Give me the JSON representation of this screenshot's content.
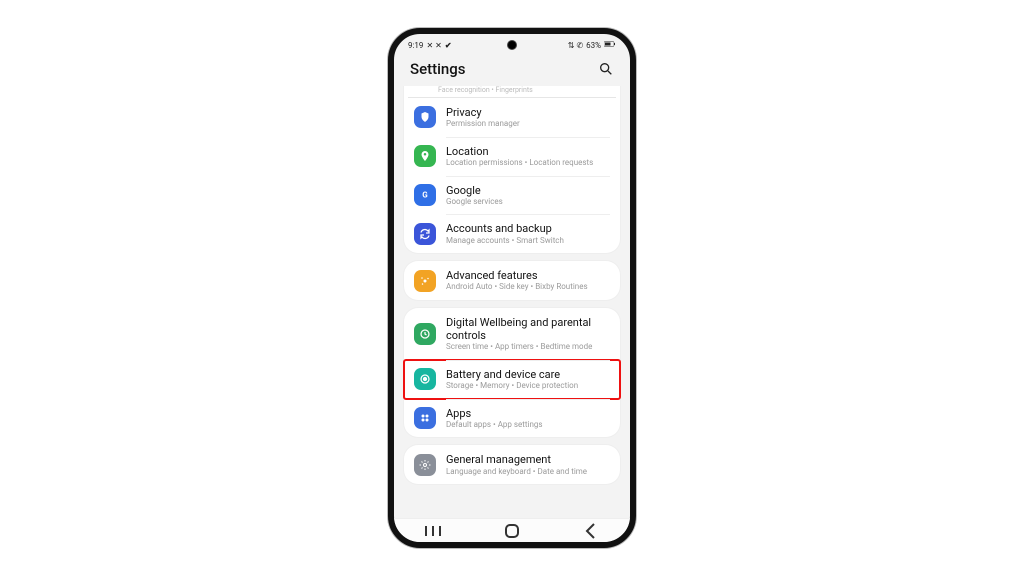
{
  "status": {
    "time": "9:19",
    "extra_left": "✕ ✕",
    "twitter_glyph": "✔",
    "right_icons": "⇅ ✆",
    "battery_text": "63%"
  },
  "header": {
    "title": "Settings",
    "search_icon": "search"
  },
  "cut_row_text": "Face recognition  •  Fingerprints",
  "group1": [
    {
      "icon_color": "#3b6fe0",
      "icon": "shield",
      "title": "Privacy",
      "sub": "Permission manager"
    },
    {
      "icon_color": "#35b651",
      "icon": "pin",
      "title": "Location",
      "sub": "Location permissions  •  Location requests"
    },
    {
      "icon_color": "#2f6fe6",
      "icon": "google",
      "title": "Google",
      "sub": "Google services"
    },
    {
      "icon_color": "#3b55d9",
      "icon": "sync",
      "title": "Accounts and backup",
      "sub": "Manage accounts  •  Smart Switch"
    }
  ],
  "group2": [
    {
      "icon_color": "#f2a324",
      "icon": "sparkle",
      "title": "Advanced features",
      "sub": "Android Auto  •  Side key  •  Bixby Routines"
    }
  ],
  "group3": [
    {
      "icon_color": "#2fa861",
      "icon": "wellbeing",
      "title": "Digital Wellbeing and parental controls",
      "sub": "Screen time  •  App timers  •  Bedtime mode"
    },
    {
      "icon_color": "#17b6a0",
      "icon": "battery",
      "title": "Battery and device care",
      "sub": "Storage  •  Memory  •  Device protection",
      "highlight": true
    },
    {
      "icon_color": "#3b6fe0",
      "icon": "apps",
      "title": "Apps",
      "sub": "Default apps  •  App settings"
    }
  ],
  "group4": [
    {
      "icon_color": "#8a8f99",
      "icon": "gear",
      "title": "General management",
      "sub": "Language and keyboard  •  Date and time"
    }
  ],
  "nav": {
    "recents": "|||",
    "home": "◯",
    "back": "‹"
  }
}
